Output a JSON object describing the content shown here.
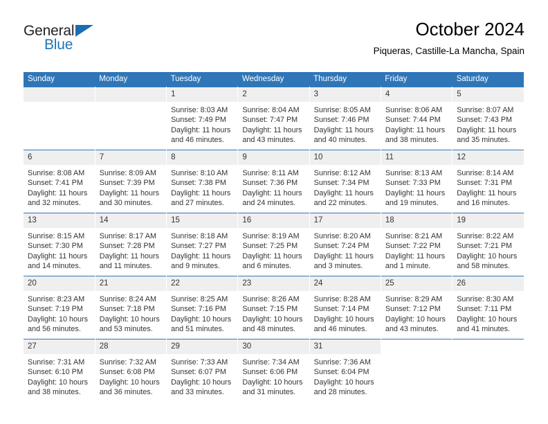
{
  "brand": {
    "line1": "General",
    "line2": "Blue",
    "triangle_color": "#1b6cb0",
    "line2_color": "#1b76bc"
  },
  "header": {
    "title": "October 2024",
    "subtitle": "Piqueras, Castille-La Mancha, Spain"
  },
  "theme": {
    "header_blue": "#2f76b8",
    "daynum_band": "#efefef",
    "text": "#333333"
  },
  "weekdays": [
    "Sunday",
    "Monday",
    "Tuesday",
    "Wednesday",
    "Thursday",
    "Friday",
    "Saturday"
  ],
  "weeks": [
    [
      {
        "day": "",
        "sunrise": "",
        "sunset": "",
        "daylight1": "",
        "daylight2": ""
      },
      {
        "day": "",
        "sunrise": "",
        "sunset": "",
        "daylight1": "",
        "daylight2": ""
      },
      {
        "day": "1",
        "sunrise": "Sunrise: 8:03 AM",
        "sunset": "Sunset: 7:49 PM",
        "daylight1": "Daylight: 11 hours",
        "daylight2": "and 46 minutes."
      },
      {
        "day": "2",
        "sunrise": "Sunrise: 8:04 AM",
        "sunset": "Sunset: 7:47 PM",
        "daylight1": "Daylight: 11 hours",
        "daylight2": "and 43 minutes."
      },
      {
        "day": "3",
        "sunrise": "Sunrise: 8:05 AM",
        "sunset": "Sunset: 7:46 PM",
        "daylight1": "Daylight: 11 hours",
        "daylight2": "and 40 minutes."
      },
      {
        "day": "4",
        "sunrise": "Sunrise: 8:06 AM",
        "sunset": "Sunset: 7:44 PM",
        "daylight1": "Daylight: 11 hours",
        "daylight2": "and 38 minutes."
      },
      {
        "day": "5",
        "sunrise": "Sunrise: 8:07 AM",
        "sunset": "Sunset: 7:43 PM",
        "daylight1": "Daylight: 11 hours",
        "daylight2": "and 35 minutes."
      }
    ],
    [
      {
        "day": "6",
        "sunrise": "Sunrise: 8:08 AM",
        "sunset": "Sunset: 7:41 PM",
        "daylight1": "Daylight: 11 hours",
        "daylight2": "and 32 minutes."
      },
      {
        "day": "7",
        "sunrise": "Sunrise: 8:09 AM",
        "sunset": "Sunset: 7:39 PM",
        "daylight1": "Daylight: 11 hours",
        "daylight2": "and 30 minutes."
      },
      {
        "day": "8",
        "sunrise": "Sunrise: 8:10 AM",
        "sunset": "Sunset: 7:38 PM",
        "daylight1": "Daylight: 11 hours",
        "daylight2": "and 27 minutes."
      },
      {
        "day": "9",
        "sunrise": "Sunrise: 8:11 AM",
        "sunset": "Sunset: 7:36 PM",
        "daylight1": "Daylight: 11 hours",
        "daylight2": "and 24 minutes."
      },
      {
        "day": "10",
        "sunrise": "Sunrise: 8:12 AM",
        "sunset": "Sunset: 7:34 PM",
        "daylight1": "Daylight: 11 hours",
        "daylight2": "and 22 minutes."
      },
      {
        "day": "11",
        "sunrise": "Sunrise: 8:13 AM",
        "sunset": "Sunset: 7:33 PM",
        "daylight1": "Daylight: 11 hours",
        "daylight2": "and 19 minutes."
      },
      {
        "day": "12",
        "sunrise": "Sunrise: 8:14 AM",
        "sunset": "Sunset: 7:31 PM",
        "daylight1": "Daylight: 11 hours",
        "daylight2": "and 16 minutes."
      }
    ],
    [
      {
        "day": "13",
        "sunrise": "Sunrise: 8:15 AM",
        "sunset": "Sunset: 7:30 PM",
        "daylight1": "Daylight: 11 hours",
        "daylight2": "and 14 minutes."
      },
      {
        "day": "14",
        "sunrise": "Sunrise: 8:17 AM",
        "sunset": "Sunset: 7:28 PM",
        "daylight1": "Daylight: 11 hours",
        "daylight2": "and 11 minutes."
      },
      {
        "day": "15",
        "sunrise": "Sunrise: 8:18 AM",
        "sunset": "Sunset: 7:27 PM",
        "daylight1": "Daylight: 11 hours",
        "daylight2": "and 9 minutes."
      },
      {
        "day": "16",
        "sunrise": "Sunrise: 8:19 AM",
        "sunset": "Sunset: 7:25 PM",
        "daylight1": "Daylight: 11 hours",
        "daylight2": "and 6 minutes."
      },
      {
        "day": "17",
        "sunrise": "Sunrise: 8:20 AM",
        "sunset": "Sunset: 7:24 PM",
        "daylight1": "Daylight: 11 hours",
        "daylight2": "and 3 minutes."
      },
      {
        "day": "18",
        "sunrise": "Sunrise: 8:21 AM",
        "sunset": "Sunset: 7:22 PM",
        "daylight1": "Daylight: 11 hours",
        "daylight2": "and 1 minute."
      },
      {
        "day": "19",
        "sunrise": "Sunrise: 8:22 AM",
        "sunset": "Sunset: 7:21 PM",
        "daylight1": "Daylight: 10 hours",
        "daylight2": "and 58 minutes."
      }
    ],
    [
      {
        "day": "20",
        "sunrise": "Sunrise: 8:23 AM",
        "sunset": "Sunset: 7:19 PM",
        "daylight1": "Daylight: 10 hours",
        "daylight2": "and 56 minutes."
      },
      {
        "day": "21",
        "sunrise": "Sunrise: 8:24 AM",
        "sunset": "Sunset: 7:18 PM",
        "daylight1": "Daylight: 10 hours",
        "daylight2": "and 53 minutes."
      },
      {
        "day": "22",
        "sunrise": "Sunrise: 8:25 AM",
        "sunset": "Sunset: 7:16 PM",
        "daylight1": "Daylight: 10 hours",
        "daylight2": "and 51 minutes."
      },
      {
        "day": "23",
        "sunrise": "Sunrise: 8:26 AM",
        "sunset": "Sunset: 7:15 PM",
        "daylight1": "Daylight: 10 hours",
        "daylight2": "and 48 minutes."
      },
      {
        "day": "24",
        "sunrise": "Sunrise: 8:28 AM",
        "sunset": "Sunset: 7:14 PM",
        "daylight1": "Daylight: 10 hours",
        "daylight2": "and 46 minutes."
      },
      {
        "day": "25",
        "sunrise": "Sunrise: 8:29 AM",
        "sunset": "Sunset: 7:12 PM",
        "daylight1": "Daylight: 10 hours",
        "daylight2": "and 43 minutes."
      },
      {
        "day": "26",
        "sunrise": "Sunrise: 8:30 AM",
        "sunset": "Sunset: 7:11 PM",
        "daylight1": "Daylight: 10 hours",
        "daylight2": "and 41 minutes."
      }
    ],
    [
      {
        "day": "27",
        "sunrise": "Sunrise: 7:31 AM",
        "sunset": "Sunset: 6:10 PM",
        "daylight1": "Daylight: 10 hours",
        "daylight2": "and 38 minutes."
      },
      {
        "day": "28",
        "sunrise": "Sunrise: 7:32 AM",
        "sunset": "Sunset: 6:08 PM",
        "daylight1": "Daylight: 10 hours",
        "daylight2": "and 36 minutes."
      },
      {
        "day": "29",
        "sunrise": "Sunrise: 7:33 AM",
        "sunset": "Sunset: 6:07 PM",
        "daylight1": "Daylight: 10 hours",
        "daylight2": "and 33 minutes."
      },
      {
        "day": "30",
        "sunrise": "Sunrise: 7:34 AM",
        "sunset": "Sunset: 6:06 PM",
        "daylight1": "Daylight: 10 hours",
        "daylight2": "and 31 minutes."
      },
      {
        "day": "31",
        "sunrise": "Sunrise: 7:36 AM",
        "sunset": "Sunset: 6:04 PM",
        "daylight1": "Daylight: 10 hours",
        "daylight2": "and 28 minutes."
      },
      {
        "day": "",
        "sunrise": "",
        "sunset": "",
        "daylight1": "",
        "daylight2": ""
      },
      {
        "day": "",
        "sunrise": "",
        "sunset": "",
        "daylight1": "",
        "daylight2": ""
      }
    ]
  ]
}
